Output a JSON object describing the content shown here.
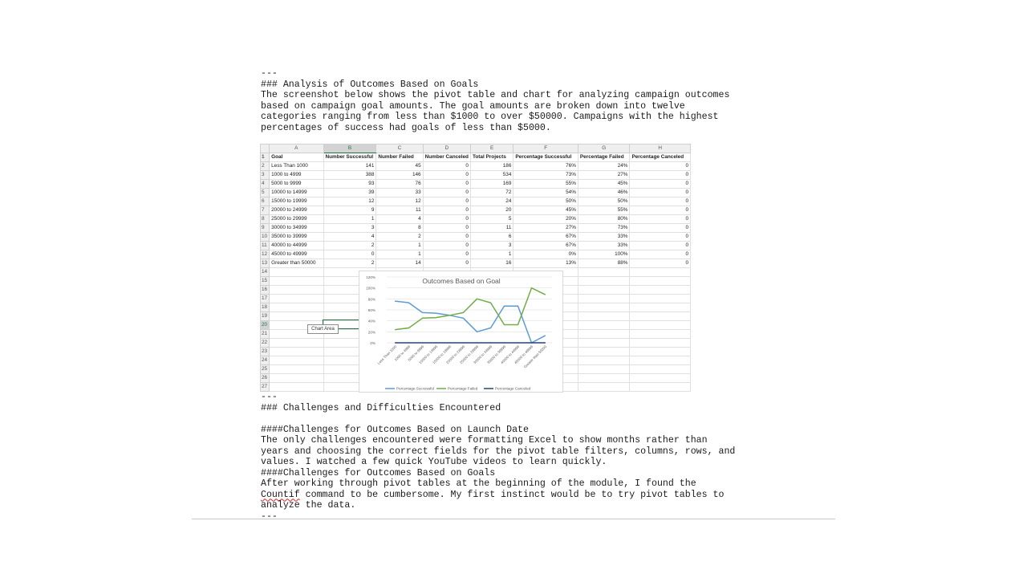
{
  "document": {
    "top_lines": [
      "---",
      "### Analysis of Outcomes Based on Goals",
      "The screenshot below shows the pivot table and chart for analyzing campaign outcomes",
      "based on campaign goal amounts. The goal amounts are broken down into twelve",
      "categories ranging from less than $1000 to over $50000. Campaigns with the highest",
      "percentages of success had goals of less than $5000."
    ],
    "bottom_lines": [
      "---",
      "### Challenges and Difficulties Encountered",
      "",
      "####Challenges for Outcomes Based on Launch Date",
      "The only challenges encountered were formatting Excel to show months rather than",
      "years and choosing the correct fields for the pivot table filters, columns, rows, and",
      "values. I watched a few quick YouTube videos to learn quickly.",
      "####Challenges for Outcomes Based on Goals",
      "After working through pivot tables at the beginning of the module, I found the",
      "",
      "analyze the data.",
      "---"
    ],
    "countif_word": "Countif",
    "countif_rest": " command to be cumbersome. My first instinct would be to try pivot tables to"
  },
  "spreadsheet": {
    "column_letters": [
      "A",
      "B",
      "C",
      "D",
      "E",
      "F",
      "G",
      "H"
    ],
    "headers": [
      "Goal",
      "Number Successful",
      "Number Failed",
      "Number Canceled",
      "Total Projects",
      "Percentage Successful",
      "Percentage Failed",
      "Percentage Canceled"
    ],
    "rows": [
      [
        "Less Than 1000",
        "141",
        "45",
        "0",
        "186",
        "76%",
        "24%",
        "0"
      ],
      [
        "1000 to 4999",
        "388",
        "146",
        "0",
        "534",
        "73%",
        "27%",
        "0"
      ],
      [
        "5000 to 9999",
        "93",
        "76",
        "0",
        "169",
        "55%",
        "45%",
        "0"
      ],
      [
        "10000 to 14999",
        "39",
        "33",
        "0",
        "72",
        "54%",
        "46%",
        "0"
      ],
      [
        "15000 to 19999",
        "12",
        "12",
        "0",
        "24",
        "50%",
        "50%",
        "0"
      ],
      [
        "20000 to 24999",
        "9",
        "11",
        "0",
        "20",
        "45%",
        "55%",
        "0"
      ],
      [
        "25000 to 29999",
        "1",
        "4",
        "0",
        "5",
        "20%",
        "80%",
        "0"
      ],
      [
        "30000 to 34999",
        "3",
        "8",
        "0",
        "11",
        "27%",
        "73%",
        "0"
      ],
      [
        "35000 to 39999",
        "4",
        "2",
        "0",
        "6",
        "67%",
        "33%",
        "0"
      ],
      [
        "40000 to 44999",
        "2",
        "1",
        "0",
        "3",
        "67%",
        "33%",
        "0"
      ],
      [
        "45000 to 49999",
        "0",
        "1",
        "0",
        "1",
        "0%",
        "100%",
        "0"
      ],
      [
        "Greater than 50000",
        "2",
        "14",
        "0",
        "16",
        "13%",
        "88%",
        "0"
      ]
    ],
    "chart_area_tooltip": "Chart Area"
  },
  "chart_data": {
    "type": "line",
    "title": "Outcomes Based on Goal",
    "categories": [
      "Less Than 1000",
      "1000 to 4999",
      "5000 to 9999",
      "10000 to 14999",
      "15000 to 19999",
      "20000 to 24999",
      "25000 to 29999",
      "30000 to 34999",
      "35000 to 39999",
      "40000 to 44999",
      "45000 to 49999",
      "Greater than 50000"
    ],
    "series": [
      {
        "name": "Percentage Successful",
        "color": "#5b9bd5",
        "values": [
          76,
          73,
          55,
          54,
          50,
          45,
          20,
          27,
          67,
          67,
          0,
          13
        ]
      },
      {
        "name": "Percentage Failed",
        "color": "#70ad47",
        "values": [
          24,
          27,
          45,
          46,
          50,
          55,
          80,
          73,
          33,
          33,
          100,
          88
        ]
      },
      {
        "name": "Percentage Canceled",
        "color": "#264478",
        "values": [
          0,
          0,
          0,
          0,
          0,
          0,
          0,
          0,
          0,
          0,
          0,
          0
        ]
      }
    ],
    "y_ticks": [
      "0%",
      "20%",
      "40%",
      "60%",
      "80%",
      "100%",
      "120%"
    ],
    "ylim": [
      0,
      120
    ],
    "grid": true,
    "legend_position": "bottom"
  }
}
